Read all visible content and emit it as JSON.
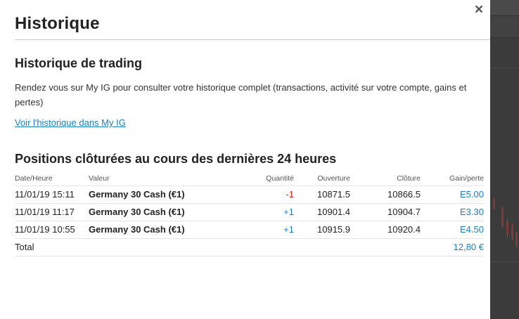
{
  "modal": {
    "title": "Historique",
    "close_label": "×",
    "trading_history": {
      "heading": "Historique de trading",
      "description": "Rendez vous sur My IG pour consulter votre historique complet (transactions, activité sur votre compte, gains et pertes)",
      "link_label": "Voir l'historique dans My IG"
    },
    "closed_positions": {
      "heading": "Positions clôturées au cours des dernières 24 heures",
      "columns": {
        "date": "Date/Heure",
        "value": "Valeur",
        "quantity": "Quantité",
        "open": "Ouverture",
        "close": "Clôture",
        "gain": "Gain/perte"
      },
      "rows": [
        {
          "date": "11/01/19 15:11",
          "value": "Germany 30 Cash (€1)",
          "quantity": "-1",
          "open": "10871.5",
          "close": "10866.5",
          "gain": "E5.00"
        },
        {
          "date": "11/01/19 11:17",
          "value": "Germany 30 Cash (€1)",
          "quantity": "+1",
          "open": "10901.4",
          "close": "10904.7",
          "gain": "E3.30"
        },
        {
          "date": "11/01/19 10:55",
          "value": "Germany 30 Cash (€1)",
          "quantity": "+1",
          "open": "10915.9",
          "close": "10920.4",
          "gain": "E4.50"
        }
      ],
      "total": {
        "label": "Total",
        "value": "12,80 €"
      }
    }
  },
  "colors": {
    "accent": "#1a7fc1",
    "negative": "#d0201a",
    "overlay": "#3a3a3a"
  }
}
